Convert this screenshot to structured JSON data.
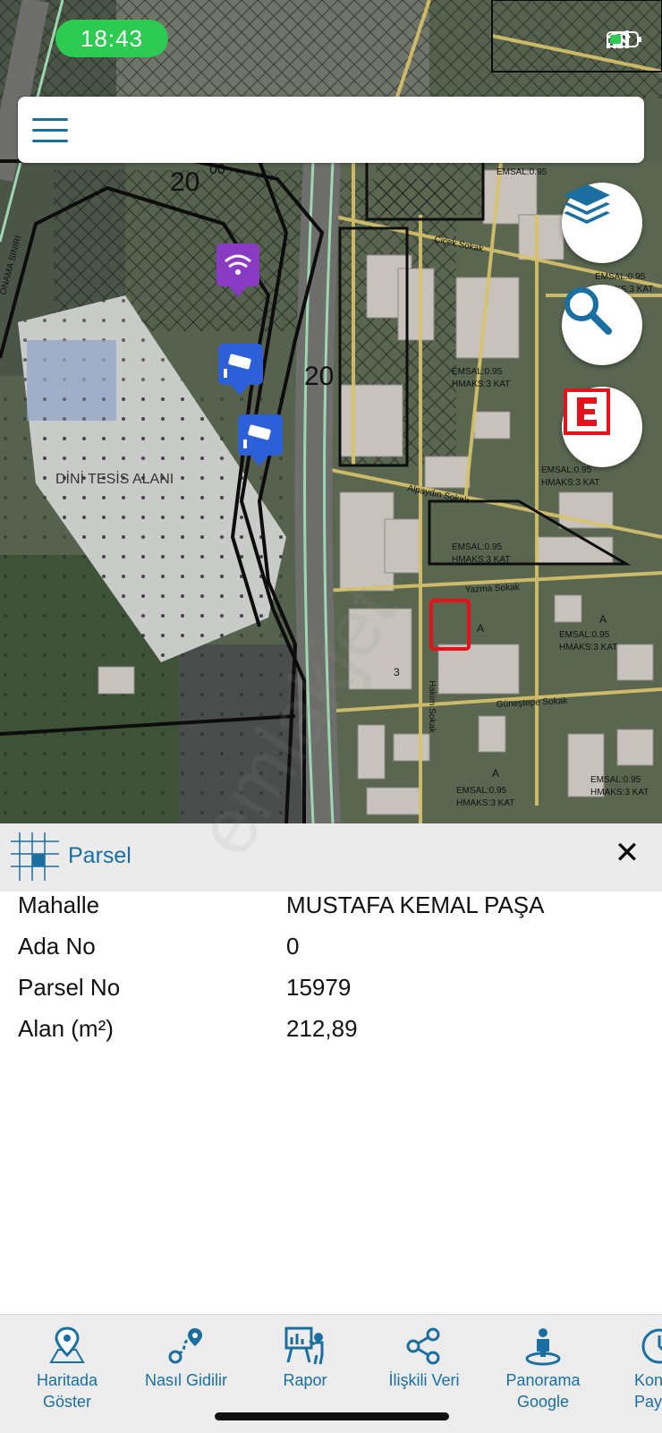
{
  "status_bar": {
    "time": "18:43"
  },
  "map": {
    "labels": {
      "zone_number_1": "20",
      "zone_number_sup": "00",
      "zone_number_2": "20",
      "religious_area": "DİNİ TESİS ALANI",
      "emsal": "EMSAL:0.95",
      "hmaks": "HMAKS:3 KAT",
      "zone_letter": "A",
      "street_1": "Alpaydın Sokak",
      "street_2": "Yazma Sokak",
      "street_3": "Güneştepe Sokak",
      "street_4": "Hakim Sokak",
      "street_5": "Çiçek Sokak",
      "boundary": "ONAMA SINIRI",
      "parcel_no_label": "3"
    }
  },
  "panel": {
    "title": "Parsel",
    "rows": [
      {
        "label": "Mahalle",
        "value": "MUSTAFA KEMAL PAŞA"
      },
      {
        "label": "Ada No",
        "value": "0"
      },
      {
        "label": "Parsel No",
        "value": "15979"
      },
      {
        "label": "Alan (m²)",
        "value": "212,89"
      }
    ]
  },
  "watermark": "emlakjet",
  "bottom_nav": [
    {
      "label_1": "Haritada",
      "label_2": "Göster",
      "icon": "map-pin-icon"
    },
    {
      "label_1": "Nasıl Gidilir",
      "label_2": "",
      "icon": "route-icon"
    },
    {
      "label_1": "Rapor",
      "label_2": "",
      "icon": "report-icon"
    },
    {
      "label_1": "İlişkili Veri",
      "label_2": "",
      "icon": "share-icon"
    },
    {
      "label_1": "Panorama",
      "label_2": "Google",
      "icon": "streetview-icon"
    },
    {
      "label_1": "Kon",
      "label_2": "Pay",
      "icon": "location-share-icon"
    }
  ],
  "colors": {
    "accent": "#1a6fa0",
    "status_green": "#2ecb52",
    "parcel_red": "#e5121b",
    "road_yellow": "#d8c46a"
  }
}
